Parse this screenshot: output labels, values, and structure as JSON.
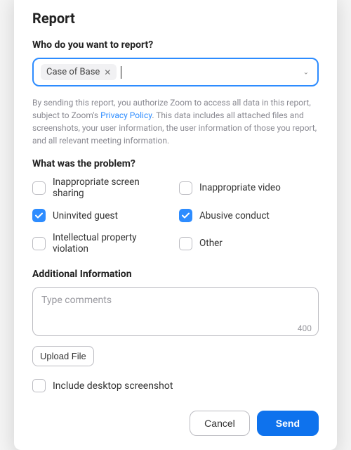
{
  "title": "Report",
  "who_label": "Who do you want to report?",
  "selected_chip": "Case of Base",
  "disclaimer_prefix": "By sending this report, you authorize Zoom to access all data in this report, subject to Zoom's ",
  "disclaimer_link": "Privacy Policy",
  "disclaimer_suffix": ". This data includes all attached files and screenshots, your user information, the user information of those you report, and all relevant meeting information.",
  "problem_label": "What was the problem?",
  "problems": [
    {
      "label": "Inappropriate screen sharing",
      "checked": false
    },
    {
      "label": "Inappropriate video",
      "checked": false
    },
    {
      "label": "Uninvited guest",
      "checked": true
    },
    {
      "label": "Abusive conduct",
      "checked": true
    },
    {
      "label": "Intellectual property violation",
      "checked": false
    },
    {
      "label": "Other",
      "checked": false
    }
  ],
  "additional_label": "Additional Information",
  "comments_placeholder": "Type comments",
  "char_limit": "400",
  "upload_label": "Upload File",
  "include_screenshot_label": "Include desktop screenshot",
  "include_screenshot_checked": false,
  "cancel_label": "Cancel",
  "send_label": "Send"
}
